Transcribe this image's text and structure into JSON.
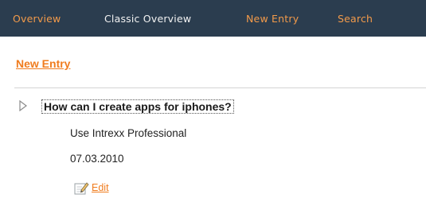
{
  "nav": {
    "items": [
      {
        "label": "Overview"
      },
      {
        "label": "Classic Overview"
      },
      {
        "label": "New Entry"
      },
      {
        "label": "Search"
      }
    ]
  },
  "main": {
    "new_entry_label": "New Entry",
    "entry": {
      "question": "How can I create apps for iphones?",
      "answer": "Use Intrexx Professional",
      "date": "07.03.2010",
      "edit_label": "Edit"
    }
  },
  "icons": {
    "expander": "triangle-right-icon",
    "edit": "pencil-note-icon"
  },
  "colors": {
    "navbar_bg": "#2b3d4f",
    "accent_orange": "#f07c1e",
    "nav_orange": "#f29a4a"
  }
}
